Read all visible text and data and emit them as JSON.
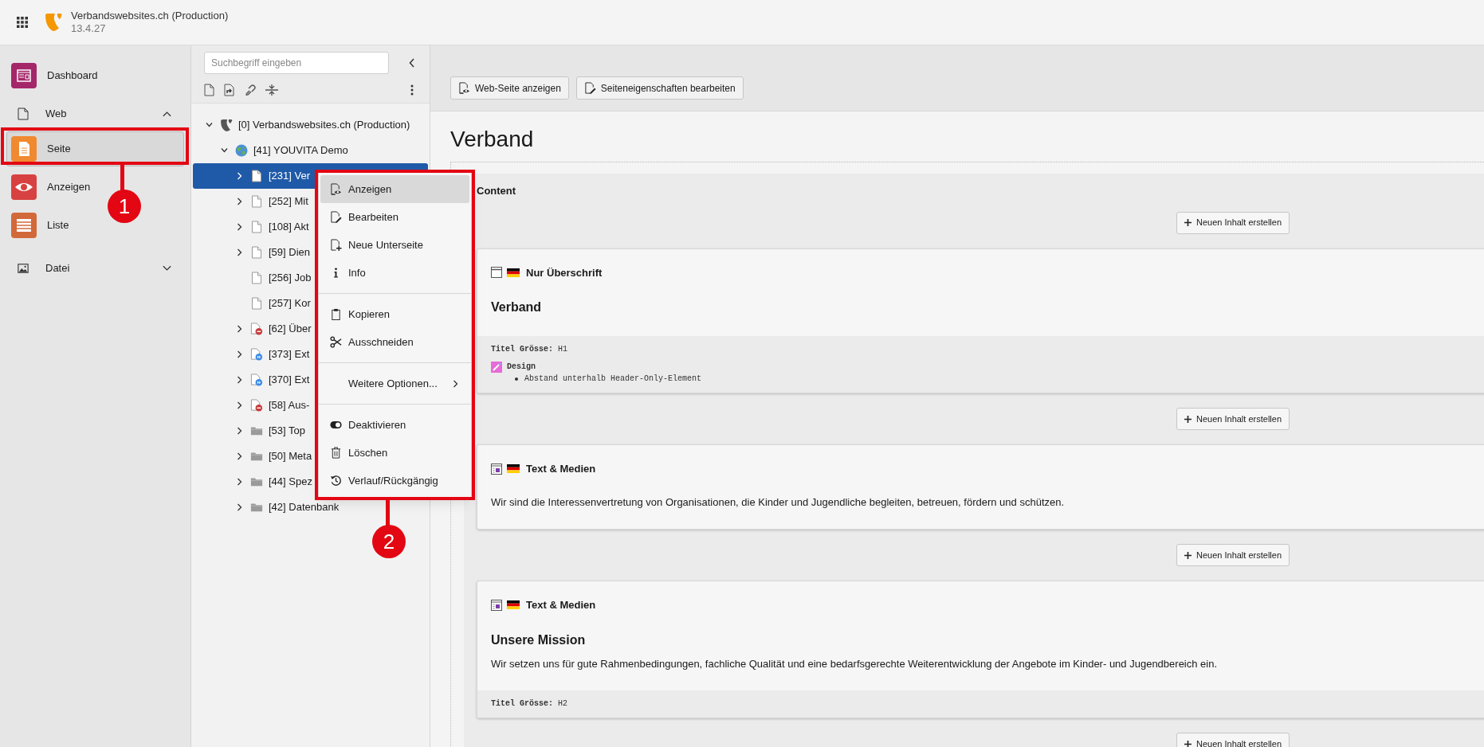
{
  "header": {
    "title": "Verbandswebsites.ch (Production)",
    "version": "13.4.27"
  },
  "sidebar": {
    "items": [
      {
        "kind": "module",
        "label": "Dashboard",
        "color": "#a4276a",
        "selected": false
      },
      {
        "kind": "group",
        "label": "Web",
        "expanded": true
      },
      {
        "kind": "module",
        "label": "Seite",
        "color": "#f08a30",
        "selected": true
      },
      {
        "kind": "module",
        "label": "Anzeigen",
        "color": "#d84141",
        "selected": false
      },
      {
        "kind": "module",
        "label": "Liste",
        "color": "#d2693a",
        "selected": false
      },
      {
        "kind": "group",
        "label": "Datei",
        "expanded": false
      }
    ]
  },
  "page_tree": {
    "search": {
      "placeholder": "Suchbegriff eingeben"
    },
    "items": [
      {
        "kind": "root",
        "label": "[0] Verbandswebsites.ch (Production)",
        "expandable": true,
        "expanded": true,
        "selected": false,
        "children": [
          {
            "kind": "site",
            "label": "[41] YOUVITA Demo",
            "expandable": true,
            "expanded": true,
            "selected": false,
            "children": [
              {
                "kind": "page",
                "label": "[231] Ver",
                "expandable": true,
                "selected": true
              },
              {
                "kind": "page",
                "label": "[252] Mit",
                "expandable": true,
                "selected": false
              },
              {
                "kind": "page",
                "label": "[108] Akt",
                "expandable": true,
                "selected": false
              },
              {
                "kind": "page",
                "label": "[59] Dien",
                "expandable": true,
                "selected": false
              },
              {
                "kind": "page",
                "label": "[256] Job",
                "expandable": false,
                "selected": false
              },
              {
                "kind": "page",
                "label": "[257] Kor",
                "expandable": false,
                "selected": false
              },
              {
                "kind": "hidden-page",
                "label": "[62] Über",
                "expandable": true,
                "selected": false
              },
              {
                "kind": "shortcut",
                "label": "[373] Ext",
                "expandable": true,
                "selected": false
              },
              {
                "kind": "shortcut",
                "label": "[370] Ext",
                "expandable": true,
                "selected": false
              },
              {
                "kind": "hidden-page",
                "label": "[58] Aus-",
                "expandable": true,
                "selected": false
              },
              {
                "kind": "folder",
                "label": "[53] Top",
                "expandable": true,
                "selected": false
              },
              {
                "kind": "folder",
                "label": "[50] Meta",
                "expandable": true,
                "selected": false
              },
              {
                "kind": "folder",
                "label": "[44] Spez",
                "expandable": true,
                "selected": false
              },
              {
                "kind": "folder",
                "label": "[42] Datenbank",
                "expandable": true,
                "selected": false
              }
            ]
          }
        ]
      }
    ]
  },
  "context_menu": {
    "sections": [
      [
        {
          "label": "Anzeigen",
          "selected": true
        },
        {
          "label": "Bearbeiten",
          "selected": false
        },
        {
          "label": "Neue Unterseite",
          "selected": false
        },
        {
          "label": "Info",
          "selected": false
        }
      ],
      [
        {
          "label": "Kopieren",
          "selected": false
        },
        {
          "label": "Ausschneiden",
          "selected": false
        }
      ],
      [
        {
          "label": "Weitere Optionen...",
          "selected": false,
          "submenu": true
        }
      ],
      [
        {
          "label": "Deaktivieren",
          "selected": false
        },
        {
          "label": "Löschen",
          "selected": false
        },
        {
          "label": "Verlauf/Rückgängig",
          "selected": false
        }
      ]
    ]
  },
  "toolbar": {
    "buttons": [
      "Web-Seite anzeigen",
      "Seiteneigenschaften bearbeiten"
    ]
  },
  "page_title": "Verband",
  "column": {
    "title": "Content",
    "new_buttons": [
      "Neuen Inhalt erstellen",
      "Neuen Inhalt erstellen",
      "Neuen Inhalt erstellen",
      "Neuen Inhalt erstellen"
    ],
    "elements": [
      {
        "kind": "header",
        "type_label": "Nur Überschrift",
        "headline": "Verband",
        "footer": {
          "field": "**Titel Grösse:** H1",
          "design_label": "Design",
          "design_items": [
            "Abstand unterhalb Header-Only-Element"
          ]
        }
      },
      {
        "kind": "textmedia",
        "type_label": "Text & Medien",
        "body": "Wir sind die Interessenvertretung von Organisationen, die Kinder und Jugendliche begleiten, betreuen, fördern und schützen."
      },
      {
        "kind": "textmedia",
        "type_label": "Text & Medien",
        "headline": "Unsere Mission",
        "body": "Wir setzen uns für gute Rahmenbedingungen, fachliche Qualität und eine bedarfsgerechte Weiterentwicklung der Angebote im Kinder- und Jugendbereich ein.",
        "footer": {
          "field": "**Titel Grösse:** H2"
        }
      }
    ]
  },
  "annotations": [
    {
      "number": "1"
    },
    {
      "number": "2"
    }
  ]
}
